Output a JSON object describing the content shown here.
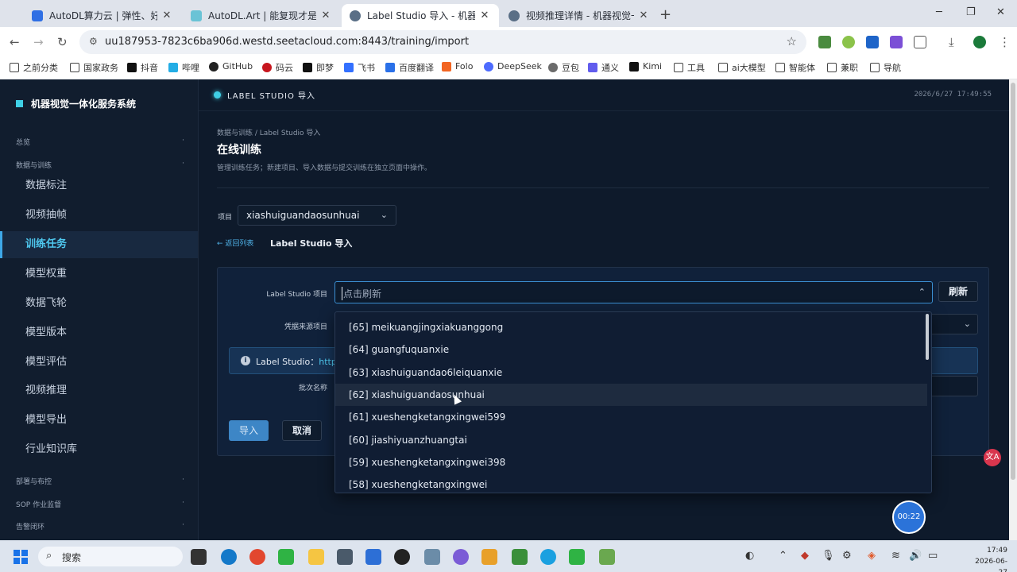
{
  "browser": {
    "tabs": [
      {
        "title": "AutoDL算力云 | 弹性、好用、",
        "color": "#2f6fe4",
        "active": false
      },
      {
        "title": "AutoDL.Art | 能复现才是好算",
        "color": "#6ac3d6",
        "active": false
      },
      {
        "title": "Label Studio 导入 - 机器视觉",
        "color": "#5a6f86",
        "active": true
      },
      {
        "title": "视频推理详情 - 机器视觉一体化",
        "color": "#5a6f86",
        "active": false
      }
    ],
    "new_tab": "+",
    "url": "uu187953-7823c6ba906d.westd.seetacloud.com:8443/training/import",
    "bookmarks": [
      "之前分类",
      "国家政务",
      "抖音",
      "哔哩",
      "GitHub",
      "码云",
      "即梦",
      "飞书",
      "百度翻译",
      "Folo",
      "DeepSeek",
      "豆包",
      "通义",
      "Kimi",
      "工具",
      "ai大模型",
      "智能体",
      "兼职",
      "导航"
    ]
  },
  "app": {
    "brand": "机器视觉一体化服务系统",
    "topbar_title": "LABEL STUDIO 导入",
    "clock": "2026/6/27 17:49:55",
    "sidebar": {
      "sections": [
        {
          "label": "总览",
          "arrow": "·"
        },
        {
          "label": "数据与训练",
          "arrow": "·"
        },
        {
          "label": "部署与布控",
          "arrow": "·"
        },
        {
          "label": "SOP 作业监督",
          "arrow": "·"
        },
        {
          "label": "告警闭环",
          "arrow": "·"
        }
      ],
      "items": [
        "数据标注",
        "视频抽帧",
        "训练任务",
        "模型权重",
        "数据飞轮",
        "模型版本",
        "模型评估",
        "视频推理",
        "模型导出",
        "行业知识库"
      ],
      "active_index": 2
    },
    "breadcrumb": "数据与训练 / Label Studio 导入",
    "page_title": "在线训练",
    "page_desc": "管理训练任务；新建项目、导入数据与提交训练在独立页面中操作。",
    "project_label": "项目",
    "project_value": "xiashuiguandaosunhuai",
    "back_link": "← 返回列表",
    "sub_title": "Label Studio 导入",
    "form": {
      "ls_project_label": "Label Studio 项目",
      "ls_project_placeholder": "点击刷新",
      "refresh_label": "刷新",
      "cred_label": "凭据来源项目",
      "info_prefix": "Label Studio：",
      "info_link": "http",
      "batch_label": "批次名称",
      "import_label": "导入",
      "cancel_label": "取消"
    },
    "dropdown_options": [
      "[65] meikuangjingxiakuanggong",
      "[64] guangfuquanxie",
      "[63] xiashuiguandao6leiquanxie",
      "[62] xiashuiguandaosunhuai",
      "[61] xueshengketangxingwei599",
      "[60] jiashiyuanzhuangtai",
      "[59] xueshengketangxingwei398",
      "[58] xueshengketangxingwei"
    ],
    "hover_index": 3,
    "translate_badge": "文A",
    "timer": "00:22"
  },
  "taskbar": {
    "search_label": "搜索",
    "time": "17:49",
    "date": "2026-06-27"
  },
  "colors": {
    "accent": "#3fd0e6",
    "active_nav": "#4fc9f0",
    "primary_button": "#3d86c6"
  }
}
